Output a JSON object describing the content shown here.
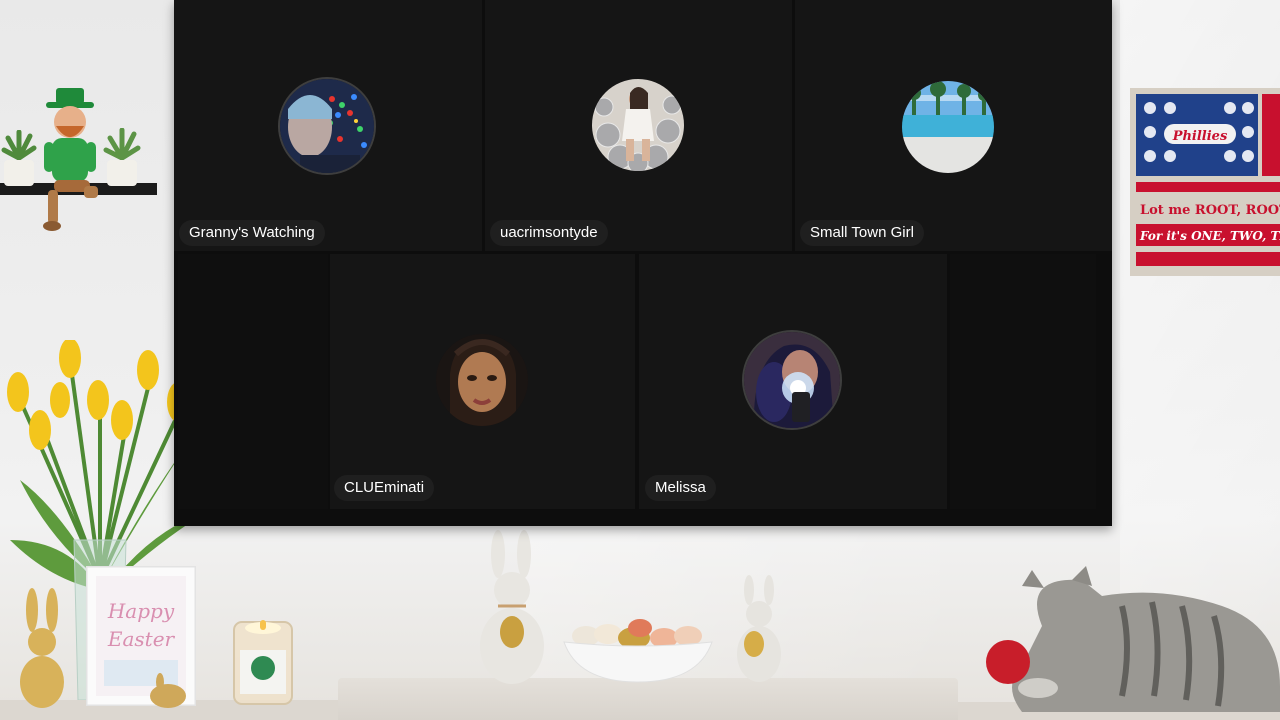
{
  "participants": [
    {
      "name": "Granny's Watching",
      "avatar_icon": "colorful-lights-selfie-avatar"
    },
    {
      "name": "uacrimsontyde",
      "avatar_icon": "disco-ball-photo-avatar"
    },
    {
      "name": "Small Town Girl",
      "avatar_icon": "pool-photo-avatar"
    },
    {
      "name": "CLUEminati",
      "avatar_icon": "portrait-avatar"
    },
    {
      "name": "Melissa",
      "avatar_icon": "phone-selfie-avatar"
    }
  ],
  "background": {
    "sign_text": [
      "Phillies",
      "Lot me ROOT, ROOT, R",
      "For it's ONE, TWO, TH"
    ],
    "card_text": [
      "Happy",
      "Easter"
    ]
  },
  "colors": {
    "tile_bg": "#151515",
    "name_tag_bg": "#202020",
    "name_tag_text": "#ffffff",
    "wall": "#eeeeee"
  }
}
